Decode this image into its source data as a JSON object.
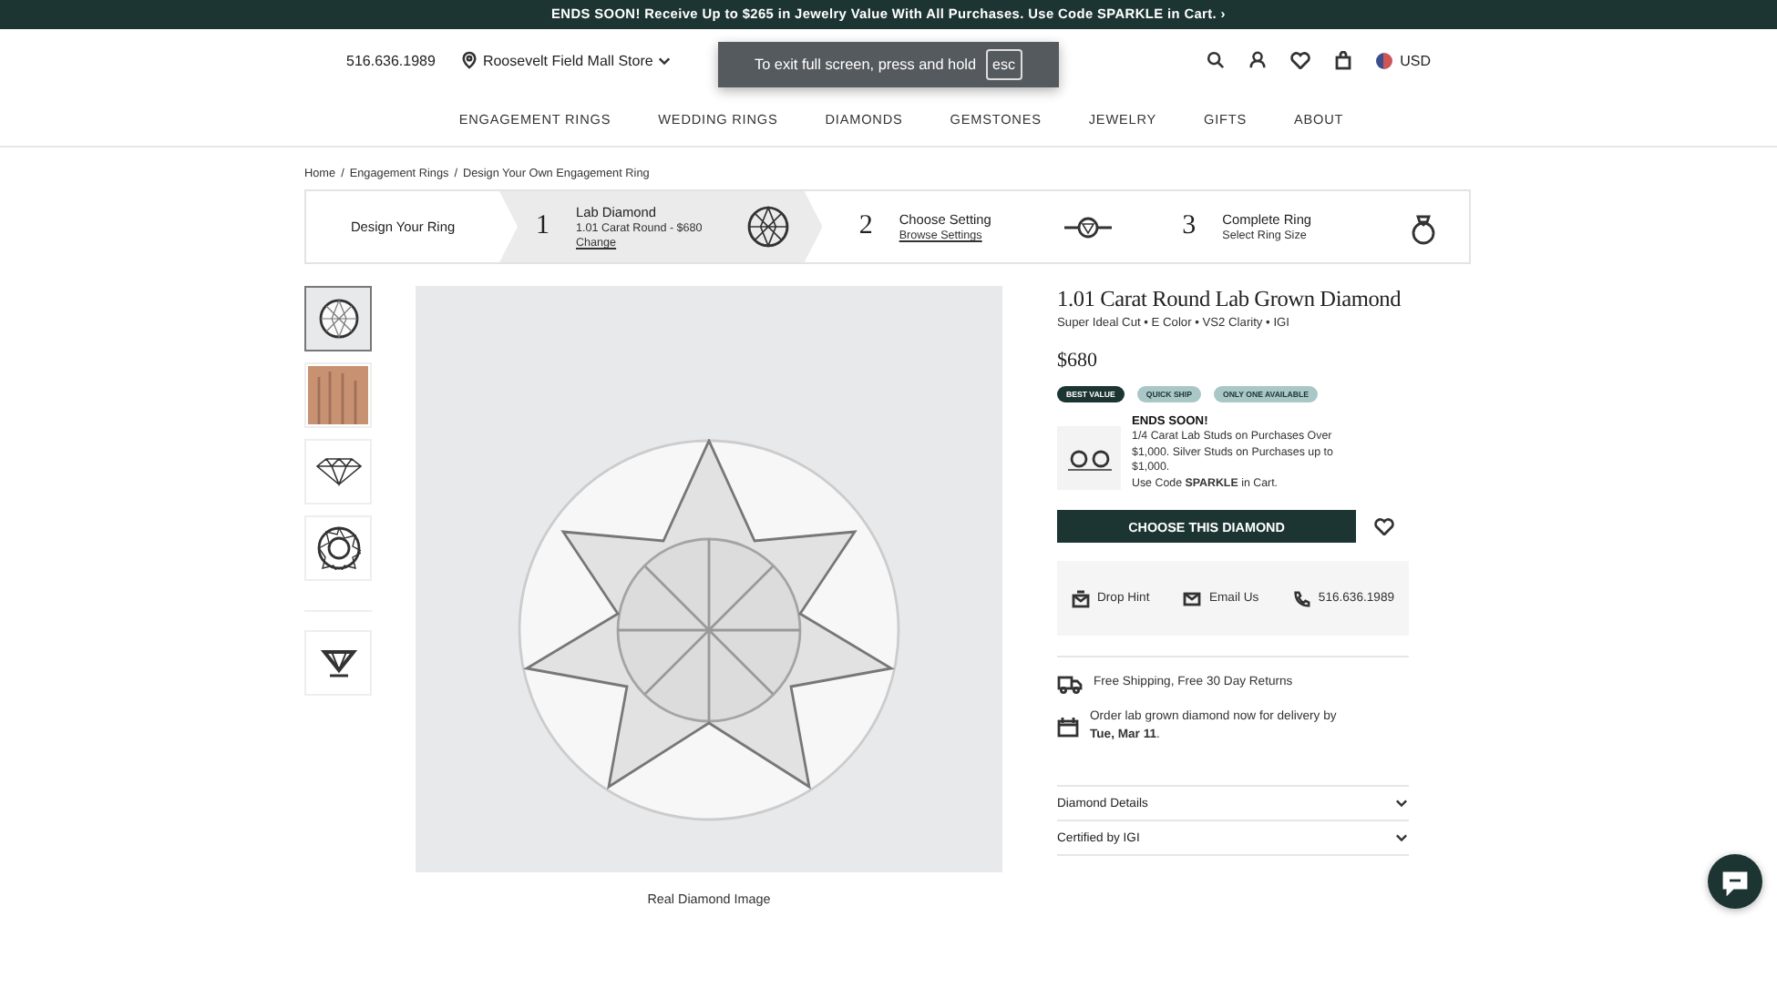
{
  "promo_bar": {
    "text": "ENDS SOON! Receive Up to $265 in Jewelry Value With All Purchases. Use Code **SPARKLE** in Cart. ›"
  },
  "header": {
    "phone": "516.636.1989",
    "store": "Roosevelt Field Mall Store",
    "currency": "USD"
  },
  "fullscreen_notice": {
    "message": "To exit full screen, press and hold",
    "key": "esc"
  },
  "nav": [
    "ENGAGEMENT RINGS",
    "WEDDING RINGS",
    "DIAMONDS",
    "GEMSTONES",
    "JEWELRY",
    "GIFTS",
    "ABOUT"
  ],
  "breadcrumbs": {
    "separator": "/",
    "items": [
      "Home",
      "Engagement Rings",
      "Design Your Own Engagement Ring"
    ]
  },
  "steps": {
    "intro": "Design Your Ring",
    "items": [
      {
        "number": "1",
        "title": "Lab Diamond",
        "detail": "1.01 Carat Round - $680",
        "link": "Change",
        "kind": "diamond",
        "selected": true
      },
      {
        "number": "2",
        "title": "Choose Setting",
        "link": "Browse Settings",
        "kind": "setting",
        "selected": false
      },
      {
        "number": "3",
        "title": "Complete Ring",
        "detail": "Select Ring Size",
        "kind": "ring",
        "selected": false
      }
    ]
  },
  "gallery": {
    "thumbnails": [
      {
        "kind": "photo",
        "selected": true
      },
      {
        "kind": "hand",
        "selected": false
      },
      {
        "kind": "side",
        "selected": false
      },
      {
        "kind": "top",
        "selected": false
      },
      {
        "kind": "video",
        "selected": false
      }
    ],
    "caption": "Real Diamond Image"
  },
  "product": {
    "title": "1.01 Carat Round Lab Grown Diamond",
    "subtitle": "Super Ideal Cut • E Color • VS2 Clarity • IGI",
    "price": "$680",
    "badges": [
      {
        "label": "BEST VALUE",
        "color": "#1c3533"
      },
      {
        "label": "QUICK SHIP",
        "color": "#a9c7c6"
      },
      {
        "label": "ONLY ONE AVAILABLE",
        "color": "#a9c7c6"
      }
    ],
    "offer": {
      "heading": "ENDS SOON!",
      "text": "1/4 Carat Lab Studs on Purchases Over $1,000. Silver Studs on Purchases up to $1,000.",
      "code_text": "Use Code **SPARKLE** in Cart."
    },
    "cta": "CHOOSE THIS DIAMOND",
    "contacts": [
      {
        "kind": "hint",
        "label": "Drop Hint"
      },
      {
        "kind": "email",
        "label": "Email Us"
      },
      {
        "kind": "phone",
        "label": "516.636.1989"
      }
    ],
    "perks": [
      {
        "kind": "shipping",
        "text": "Free Shipping, Free 30 Day Returns"
      },
      {
        "kind": "delivery",
        "text": "Order lab grown diamond now for delivery by **Tue, Mar 11**."
      }
    ],
    "accordions": [
      {
        "label": "Diamond Details",
        "expanded": false
      },
      {
        "label": "Certified by IGI",
        "expanded": false
      }
    ]
  }
}
